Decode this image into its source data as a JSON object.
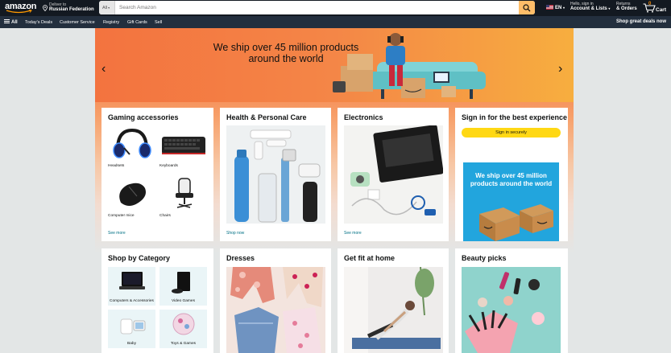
{
  "header": {
    "logo": "amazon",
    "deliver_line1": "Deliver to",
    "deliver_line2": "Russian Federation",
    "search_category": "All",
    "search_placeholder": "Search Amazon",
    "language": "EN",
    "account_line1": "Hello, sign in",
    "account_line2": "Account & Lists",
    "orders_line1": "Returns",
    "orders_line2": "& Orders",
    "cart_count": "0",
    "cart_label": "Cart"
  },
  "subnav": {
    "all": "All",
    "items": [
      "Today's Deals",
      "Customer Service",
      "Registry",
      "Gift Cards",
      "Sell"
    ],
    "right": "Shop great deals now"
  },
  "hero": {
    "headline": "We ship over 45 million products around the world"
  },
  "cards": {
    "gaming": {
      "title": "Gaming accessories",
      "items": [
        "Headsets",
        "Keyboards",
        "Computer mice",
        "Chairs"
      ],
      "link": "See more"
    },
    "health": {
      "title": "Health & Personal Care",
      "link": "Shop now"
    },
    "electronics": {
      "title": "Electronics",
      "link": "See more"
    },
    "signin": {
      "title": "Sign in for the best experience",
      "button": "Sign in securely",
      "ad_text": "We ship over 45 million products around the world"
    },
    "category": {
      "title": "Shop by Category",
      "items": [
        "Computers & Accessories",
        "Video Games",
        "Baby",
        "Toys & Games"
      ]
    },
    "dresses": {
      "title": "Dresses"
    },
    "fit": {
      "title": "Get fit at home"
    },
    "beauty": {
      "title": "Beauty picks"
    }
  },
  "colors": {
    "nav": "#131921",
    "subnav": "#232f3e",
    "search_button": "#febd69",
    "signin_button": "#ffd814",
    "link": "#007185"
  }
}
